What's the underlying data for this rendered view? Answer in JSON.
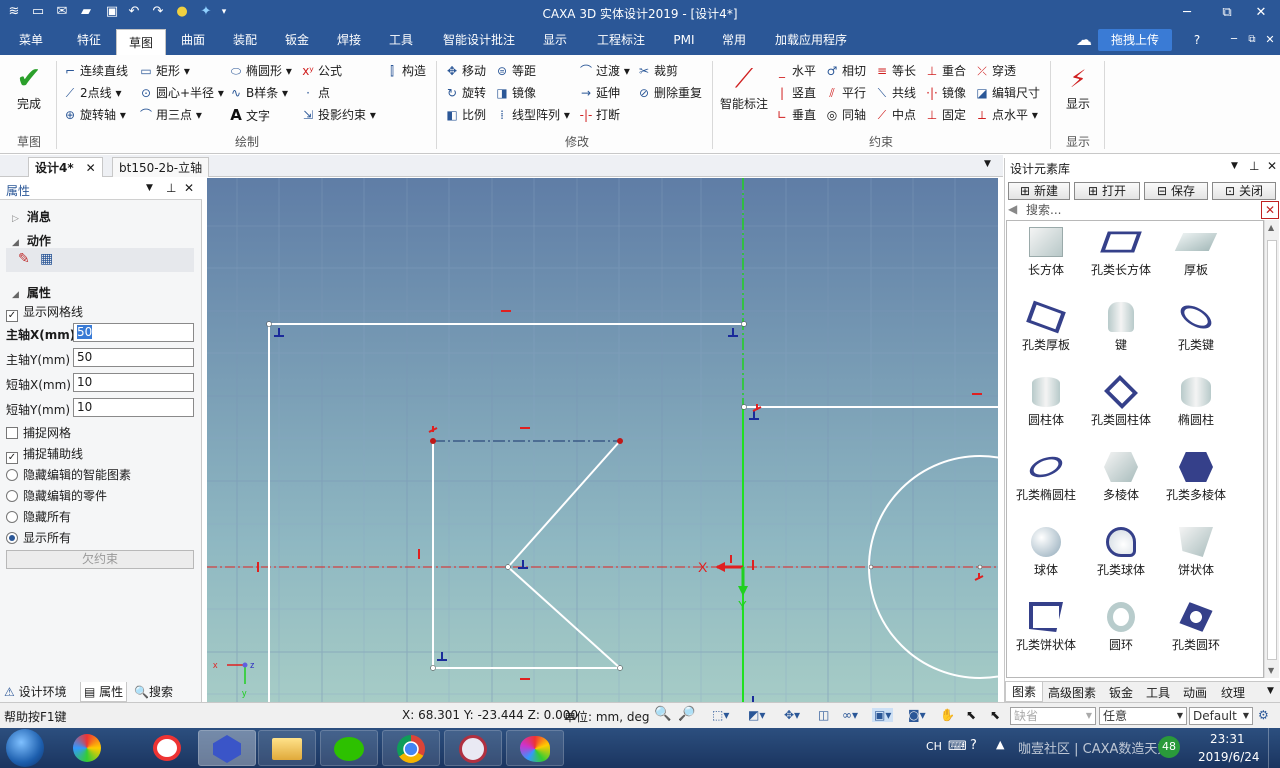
{
  "app": {
    "title": "CAXA 3D 实体设计2019 - [设计4*]",
    "win_min": "─",
    "win_max": "⧉",
    "win_close": "✕"
  },
  "menu": {
    "items": [
      "菜单",
      "特征",
      "草图",
      "曲面",
      "装配",
      "钣金",
      "焊接",
      "工具",
      "智能设计批注",
      "显示",
      "工程标注",
      "PMI",
      "常用",
      "加载应用程序"
    ],
    "upload": "拖拽上传"
  },
  "ribbon": {
    "finish": "完成",
    "groups": {
      "sketch": "草图",
      "draw": "绘制",
      "modify": "修改",
      "constraint": "约束",
      "display": "显示"
    },
    "draw": [
      "连续直线",
      "矩形",
      "椭圆形",
      "公式",
      "构造",
      "2点线",
      "圆心+半径",
      "B样条",
      "点",
      "旋转轴",
      "用三点",
      "文字",
      "投影约束"
    ],
    "modify": [
      "移动",
      "等距",
      "过渡",
      "裁剪",
      "旋转",
      "镜像",
      "延伸",
      "删除重复",
      "比例",
      "线型阵列",
      "打断"
    ],
    "constraint": [
      "智能标注",
      "水平",
      "相切",
      "等长",
      "重合",
      "穿透",
      "竖直",
      "平行",
      "共线",
      "镜像",
      "编辑尺寸",
      "垂直",
      "同轴",
      "中点",
      "固定",
      "点水平"
    ],
    "display_label": "显示"
  },
  "doc_tabs": [
    "设计4*",
    "bt150-2b-立轴"
  ],
  "left_panel": {
    "title": "属性",
    "sections": {
      "message": "消息",
      "action": "动作",
      "properties": "属性"
    },
    "show_grid": "显示网格线",
    "fields": [
      {
        "label": "主轴X(mm)",
        "value": "50"
      },
      {
        "label": "主轴Y(mm)",
        "value": "50"
      },
      {
        "label": "短轴X(mm)",
        "value": "10"
      },
      {
        "label": "短轴Y(mm)",
        "value": "10"
      }
    ],
    "snap_grid": "捕捉网格",
    "snap_aux": "捕捉辅助线",
    "radios": [
      "隐藏编辑的智能图素",
      "隐藏编辑的零件",
      "隐藏所有",
      "显示所有"
    ],
    "under_constrained": "欠约束",
    "bottom_tabs": [
      "设计环境",
      "属性",
      "搜索"
    ]
  },
  "viewport": {
    "x_axis_label": "X",
    "y_axis_label": "Y",
    "triad_x": "x",
    "triad_z": "z",
    "triad_y": "y"
  },
  "library": {
    "title": "设计元素库",
    "buttons": [
      "新建",
      "打开",
      "保存",
      "关闭"
    ],
    "search_placeholder": "搜索...",
    "items": [
      "长方体",
      "孔类长方体",
      "厚板",
      "孔类厚板",
      "键",
      "孔类键",
      "圆柱体",
      "孔类圆柱体",
      "椭圆柱",
      "孔类椭圆柱",
      "多棱体",
      "孔类多棱体",
      "球体",
      "孔类球体",
      "饼状体",
      "孔类饼状体",
      "圆环",
      "孔类圆环"
    ],
    "bottom_tabs": [
      "图素",
      "高级图素",
      "钣金",
      "工具",
      "动画",
      "纹理"
    ]
  },
  "status": {
    "help": "帮助按F1键",
    "coords": "X: 68.301 Y: -23.444 Z: 0.000",
    "units": "单位: mm, deg",
    "combo1": "缺省",
    "combo2": "任意",
    "combo3": "Default"
  },
  "taskbar": {
    "lang": "CH",
    "watermark": "咖壹社区 | CAXA数造天方",
    "time": "23:31",
    "date": "2019/6/24",
    "badge": "48"
  },
  "colors": {
    "titlebar": "#2b5797",
    "axis_red": "#e02020",
    "axis_green": "#20d020",
    "sketch": "#ffffff"
  }
}
